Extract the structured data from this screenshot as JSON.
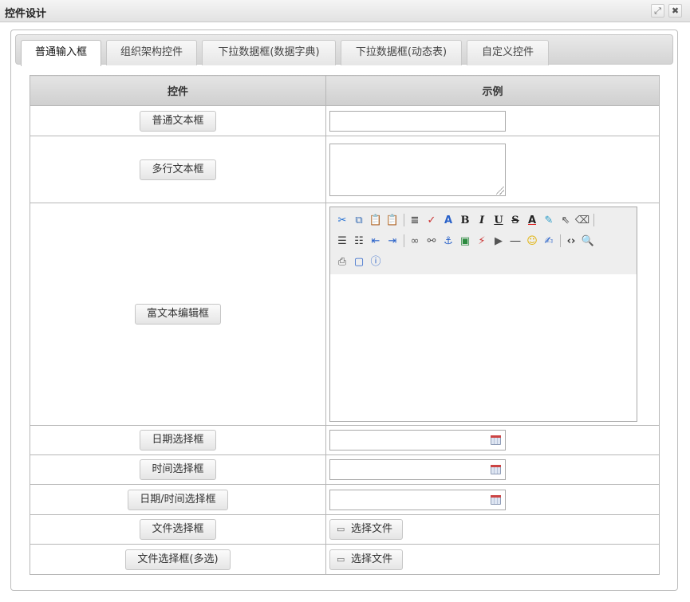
{
  "window": {
    "title": "控件设计",
    "maximize_icon": "maximize-icon",
    "close_icon": "close-icon"
  },
  "tabs": [
    {
      "label": "普通输入框",
      "active": true
    },
    {
      "label": "组织架构控件",
      "active": false
    },
    {
      "label": "下拉数据框(数据字典)",
      "active": false
    },
    {
      "label": "下拉数据框(动态表)",
      "active": false
    },
    {
      "label": "自定义控件",
      "active": false
    }
  ],
  "table": {
    "headers": [
      "控件",
      "示例"
    ],
    "rows": [
      {
        "label": "普通文本框",
        "kind": "text"
      },
      {
        "label": "多行文本框",
        "kind": "textarea"
      },
      {
        "label": "富文本编辑框",
        "kind": "richtext"
      },
      {
        "label": "日期选择框",
        "kind": "date"
      },
      {
        "label": "时间选择框",
        "kind": "time"
      },
      {
        "label": "日期/时间选择框",
        "kind": "datetime"
      },
      {
        "label": "文件选择框",
        "kind": "file"
      },
      {
        "label": "文件选择框(多选)",
        "kind": "files"
      }
    ],
    "file_button_label": "选择文件"
  },
  "editor_toolbar": {
    "rows": [
      [
        "cut-icon",
        "copy-icon",
        "paste-icon",
        "paste-word-icon",
        "|",
        "paragraph-icon",
        "spellcheck-icon",
        "font-format-icon",
        "bold-icon",
        "italic-icon",
        "underline-icon",
        "strikethrough-icon",
        "font-color-icon",
        "highlight-color-icon",
        "select-pointer-icon",
        "eraser-icon",
        "|"
      ],
      [
        "justify-icon",
        "unordered-list-icon",
        "outdent-icon",
        "indent-icon",
        "|",
        "link-icon",
        "unlink-icon",
        "anchor-icon",
        "image-icon",
        "flash-icon",
        "media-icon",
        "horizontal-rule-icon",
        "emoticon-icon",
        "edit-icon",
        "|",
        "source-code-icon",
        "preview-icon"
      ],
      [
        "print-icon",
        "fullscreen-icon",
        "about-icon"
      ]
    ]
  }
}
